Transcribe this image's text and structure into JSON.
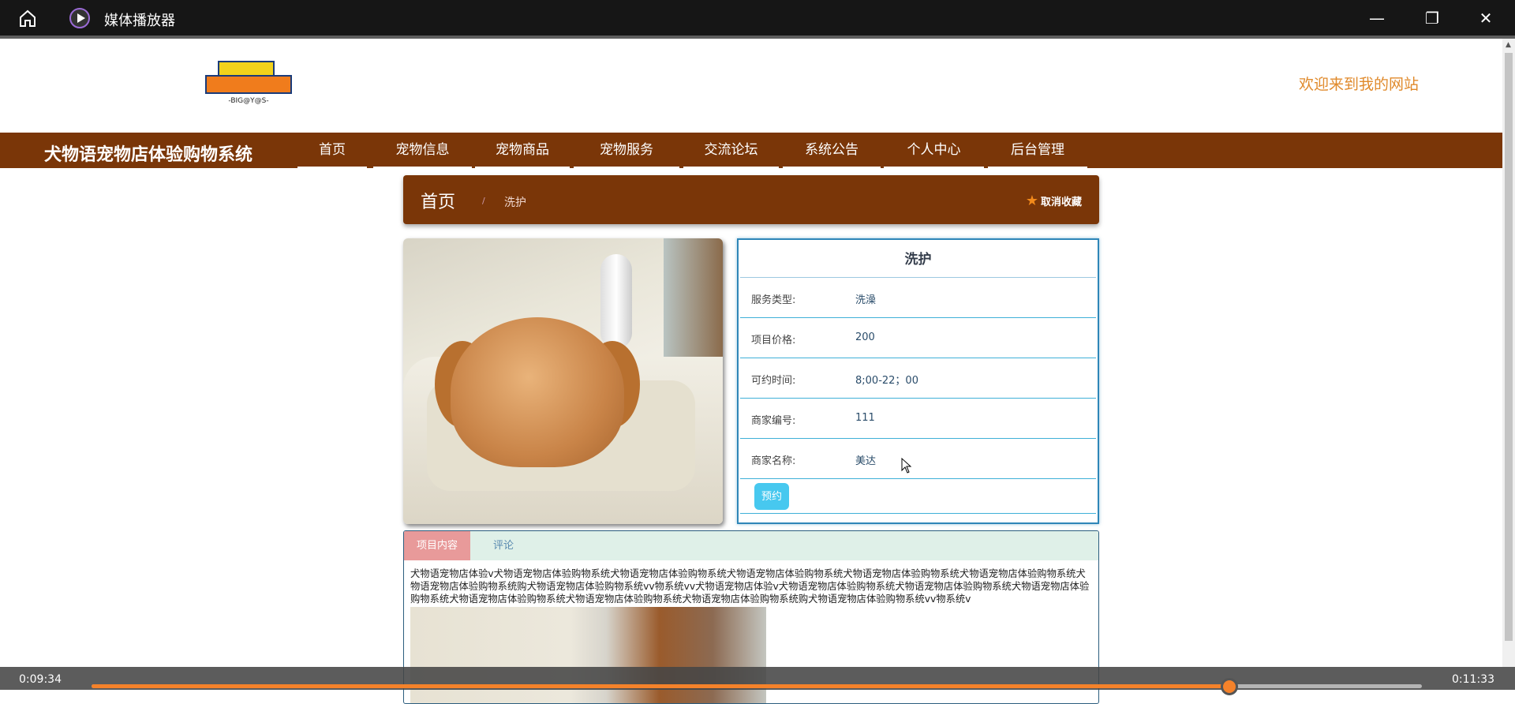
{
  "window": {
    "title": "媒体播放器",
    "icons": [
      "home-icon",
      "media-player-icon",
      "minimize-icon",
      "restore-icon",
      "close-icon"
    ]
  },
  "header": {
    "welcome": "欢迎来到我的网站",
    "logo_text": "BIG@Y@S"
  },
  "nav": {
    "site_title": "犬物语宠物店体验购物系统",
    "items": [
      "首页",
      "宠物信息",
      "宠物商品",
      "宠物服务",
      "交流论坛",
      "系统公告",
      "个人中心",
      "后台管理"
    ]
  },
  "breadcrumb": {
    "home": "首页",
    "separator": "/",
    "current": "洗护",
    "favorite": "取消收藏"
  },
  "detail": {
    "title": "洗护",
    "rows": [
      {
        "label": "服务类型:",
        "value": "洗澡"
      },
      {
        "label": "项目价格:",
        "value": "200"
      },
      {
        "label": "可约时间:",
        "value": "8;00-22；00"
      },
      {
        "label": "商家编号:",
        "value": "111"
      },
      {
        "label": "商家名称:",
        "value": "美达"
      }
    ],
    "book_button": "预约"
  },
  "tabs": {
    "items": [
      "项目内容",
      "评论"
    ],
    "content": "犬物语宠物店体验v犬物语宠物店体验购物系统犬物语宠物店体验购物系统犬物语宠物店体验购物系统犬物语宠物店体验购物系统犬物语宠物店体验购物系统犬物语宠物店体验购物系统购犬物语宠物店体验购物系统vv物系统vv犬物语宠物店体验v犬物语宠物店体验购物系统犬物语宠物店体验购物系统犬物语宠物店体验购物系统犬物语宠物店体验购物系统犬物语宠物店体验购物系统犬物语宠物店体验购物系统购犬物语宠物店体验购物系统vv物系统v"
  },
  "player": {
    "elapsed": "0:09:34",
    "total": "0:11:33",
    "progress": 0.855,
    "accent": "#f5822a"
  },
  "colors": {
    "brand": "#7a3608",
    "welcome": "#e08a2c",
    "book": "#47c8ef"
  }
}
